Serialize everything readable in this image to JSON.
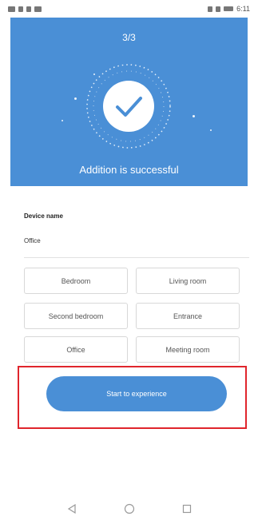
{
  "status_bar": {
    "left_icons": [
      "sim-icon",
      "signal-icon",
      "wifi-icon",
      "photo-icon"
    ],
    "right_icons": [
      "alarm-icon",
      "vibrate-icon",
      "battery-icon"
    ],
    "time": "6:11"
  },
  "header": {
    "step": "3/3",
    "success_text": "Addition is successful",
    "icon": "checkmark-icon",
    "background_color": "#4a8fd6"
  },
  "device": {
    "label": "Device name",
    "value": "Office"
  },
  "rooms": [
    {
      "label": "Bedroom"
    },
    {
      "label": "Living room"
    },
    {
      "label": "Second bedroom"
    },
    {
      "label": "Entrance"
    },
    {
      "label": "Office"
    },
    {
      "label": "Meeting room"
    }
  ],
  "actions": {
    "start_label": "Start to experience",
    "highlight_color": "#e0252c"
  },
  "nav": {
    "back_icon": "back-triangle-icon",
    "home_icon": "home-circle-icon",
    "recents_icon": "recents-square-icon"
  }
}
